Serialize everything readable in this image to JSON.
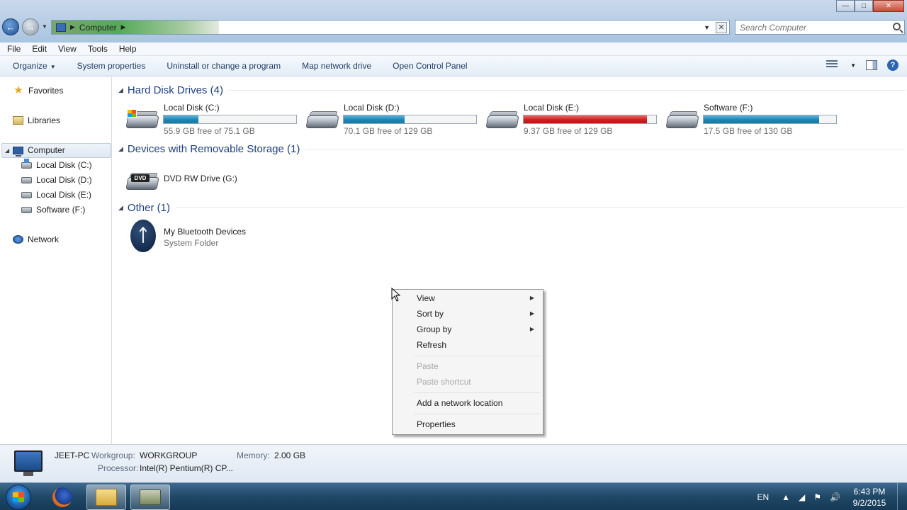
{
  "address": {
    "location": "Computer",
    "search_placeholder": "Search Computer"
  },
  "menu": [
    "File",
    "Edit",
    "View",
    "Tools",
    "Help"
  ],
  "toolbar": {
    "organize": "Organize",
    "system_properties": "System properties",
    "uninstall": "Uninstall or change a program",
    "map_drive": "Map network drive",
    "control_panel": "Open Control Panel"
  },
  "nav": {
    "favorites": "Favorites",
    "libraries": "Libraries",
    "computer": "Computer",
    "drives": [
      "Local Disk (C:)",
      "Local Disk (D:)",
      "Local Disk (E:)",
      "Software (F:)"
    ],
    "network": "Network"
  },
  "groups": {
    "hdd": "Hard Disk Drives (4)",
    "removable": "Devices with Removable Storage (1)",
    "other": "Other (1)"
  },
  "drives": [
    {
      "name": "Local Disk (C:)",
      "free": "55.9 GB free of 75.1 GB",
      "used_fraction": 0.26,
      "status": "normal"
    },
    {
      "name": "Local Disk (D:)",
      "free": "70.1 GB free of 129 GB",
      "used_fraction": 0.46,
      "status": "normal"
    },
    {
      "name": "Local Disk (E:)",
      "free": "9.37 GB free of 129 GB",
      "used_fraction": 0.93,
      "status": "low"
    },
    {
      "name": "Software (F:)",
      "free": "17.5 GB free of 130 GB",
      "used_fraction": 0.87,
      "status": "normal"
    }
  ],
  "removable": {
    "name": "DVD RW Drive (G:)",
    "badge": "DVD"
  },
  "other": {
    "name": "My Bluetooth Devices",
    "type": "System Folder"
  },
  "context_menu": {
    "view": "View",
    "sort_by": "Sort by",
    "group_by": "Group by",
    "refresh": "Refresh",
    "paste": "Paste",
    "paste_shortcut": "Paste shortcut",
    "add_network_location": "Add a network location",
    "properties": "Properties"
  },
  "details": {
    "pc_name": "JEET-PC",
    "workgroup_label": "Workgroup:",
    "workgroup": "WORKGROUP",
    "memory_label": "Memory:",
    "memory": "2.00 GB",
    "processor_label": "Processor:",
    "processor": "Intel(R) Pentium(R) CP..."
  },
  "taskbar": {
    "language": "EN",
    "time": "6:43 PM",
    "date": "9/2/2015"
  },
  "colors": {
    "bar_normal": "#1a86b5",
    "bar_low": "#d11f1f",
    "group_title": "#1e3f80"
  }
}
